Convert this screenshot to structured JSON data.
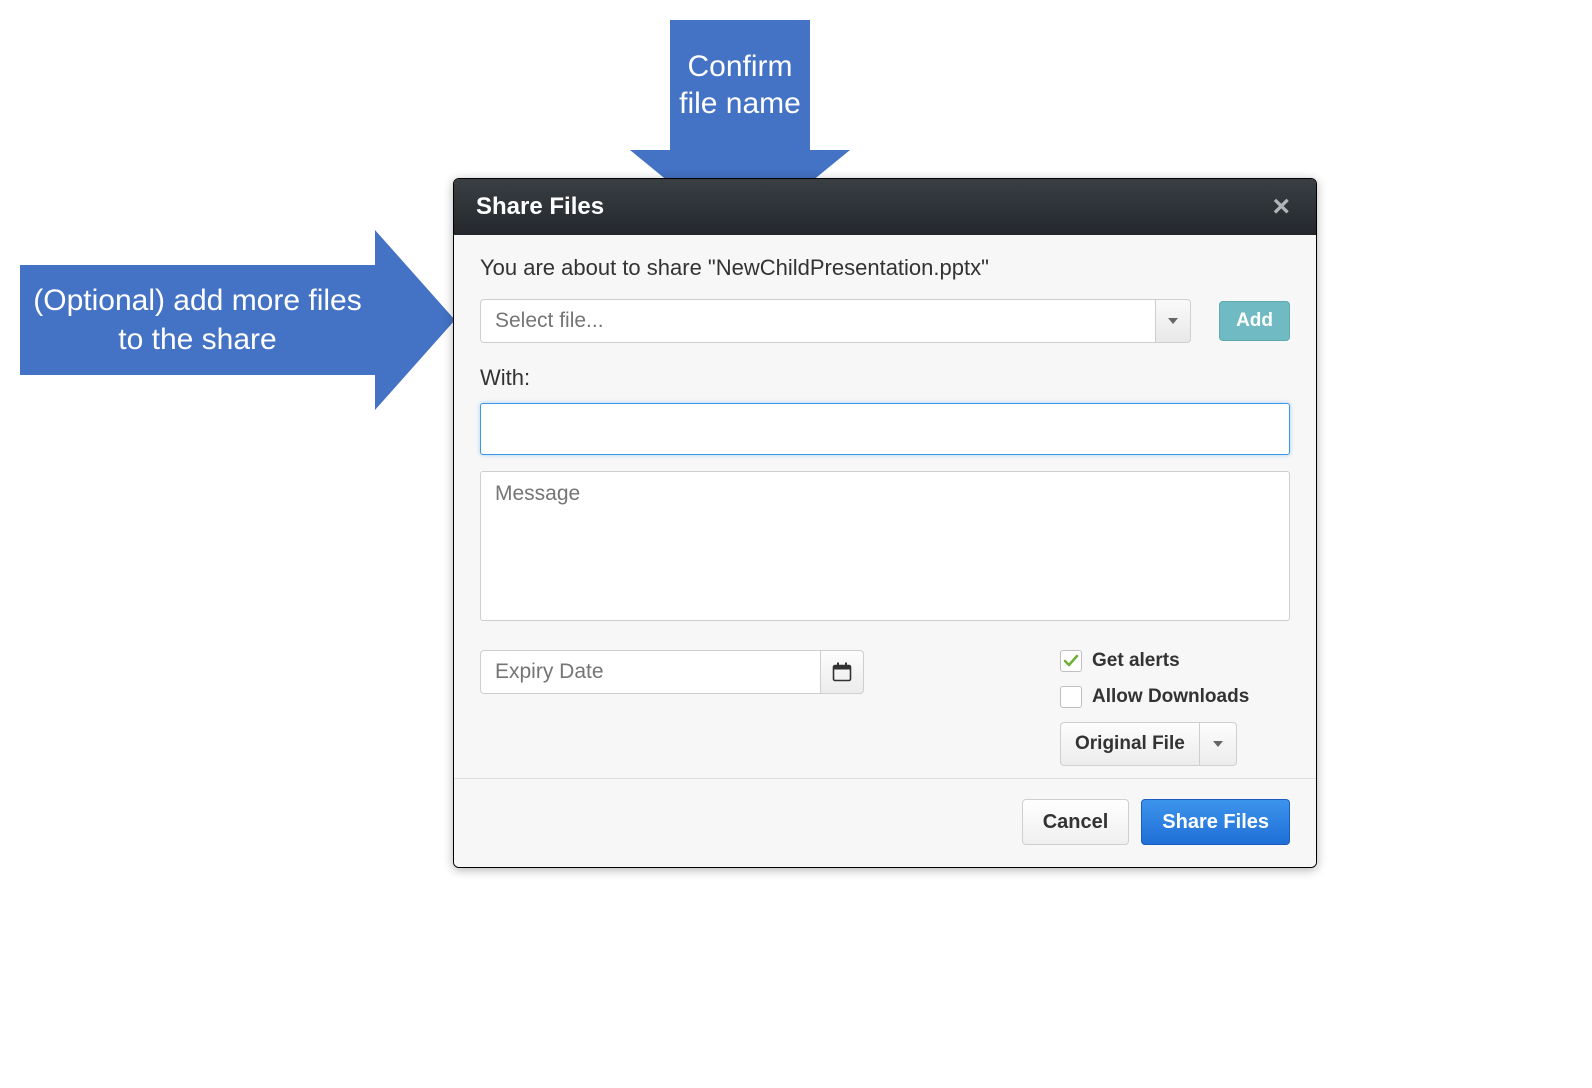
{
  "annotations": {
    "confirm": "Confirm file name",
    "add_more": "(Optional) add more files to the share"
  },
  "dialog": {
    "title": "Share Files",
    "confirm_prefix": "You are about to share \"",
    "filename": "NewChildPresentation.pptx",
    "confirm_suffix": "\"",
    "file_select_placeholder": "Select file...",
    "add_button": "Add",
    "with_label": "With:",
    "with_value": "",
    "message_placeholder": "Message",
    "expiry_placeholder": "Expiry Date",
    "options": {
      "get_alerts": {
        "label": "Get alerts",
        "checked": true
      },
      "allow_downloads": {
        "label": "Allow Downloads",
        "checked": false
      },
      "download_mode": "Original File"
    },
    "footer": {
      "cancel": "Cancel",
      "share": "Share Files"
    }
  }
}
